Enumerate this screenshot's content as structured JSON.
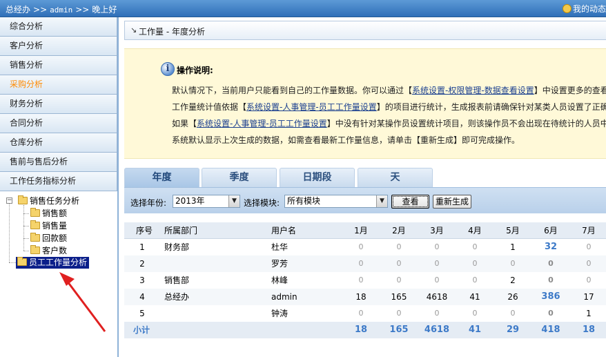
{
  "topbar": {
    "crumbs": [
      "总经办",
      "admin",
      "晚上好"
    ],
    "separator": ">>",
    "my_dynamics": "我的动态"
  },
  "sidebar": {
    "items": [
      {
        "label": "综合分析"
      },
      {
        "label": "客户分析"
      },
      {
        "label": "销售分析"
      },
      {
        "label": "采购分析",
        "active": true
      },
      {
        "label": "财务分析"
      },
      {
        "label": "合同分析"
      },
      {
        "label": "仓库分析"
      },
      {
        "label": "售前与售后分析"
      },
      {
        "label": "工作任务指标分析"
      }
    ],
    "tree": {
      "root": "销售任务分析",
      "children": [
        "销售额",
        "销售量",
        "回款额",
        "客户数"
      ],
      "selected": "员工工作量分析"
    }
  },
  "main": {
    "title": "工作量 - 年度分析",
    "notice": {
      "heading": "操作说明:",
      "line1_a": "默认情况下，当前用户只能看到自己的工作量数据。你可以通过",
      "line1_link": "系统设置-权限管理-数据查看设置",
      "line1_b": "中设置更多的查看",
      "line2_a": "工作量统计值依据",
      "line2_link": "系统设置-人事管理-员工工作量设置",
      "line2_b": "的项目进行统计，生成报表前请确保针对某类人员设置了正确",
      "line3_a": "如果",
      "line3_link": "系统设置-人事管理-员工工作量设置",
      "line3_b": "中没有针对某操作员设置统计项目，则该操作员不会出现在待统计的人员中",
      "line4": "系统默认显示上次生成的数据，如需查看最新工作量信息，请单击【重新生成】即可完成操作。"
    },
    "tabs": [
      {
        "label": "年度",
        "active": true
      },
      {
        "label": "季度"
      },
      {
        "label": "日期段"
      },
      {
        "label": "天"
      }
    ],
    "filter": {
      "year_label": "选择年份:",
      "year_value": "2013年",
      "module_label": "选择模块:",
      "module_value": "所有模块",
      "view_button": "查看",
      "regen_button": "重新生成"
    },
    "table": {
      "headers": [
        "序号",
        "所属部门",
        "用户名",
        "1月",
        "2月",
        "3月",
        "4月",
        "5月",
        "6月",
        "7月"
      ],
      "rows": [
        {
          "no": "1",
          "dept": "财务部",
          "user": "杜华",
          "m": [
            "0",
            "0",
            "0",
            "0",
            "1",
            "32",
            "0"
          ]
        },
        {
          "no": "2",
          "dept": "",
          "user": "罗芳",
          "m": [
            "0",
            "0",
            "0",
            "0",
            "0",
            "0",
            "0"
          ]
        },
        {
          "no": "3",
          "dept": "销售部",
          "user": "林峰",
          "m": [
            "0",
            "0",
            "0",
            "0",
            "2",
            "0",
            "0"
          ]
        },
        {
          "no": "4",
          "dept": "总经办",
          "user": "admin",
          "m": [
            "18",
            "165",
            "4618",
            "41",
            "26",
            "386",
            "17"
          ]
        },
        {
          "no": "5",
          "dept": "",
          "user": "钟涛",
          "m": [
            "0",
            "0",
            "0",
            "0",
            "0",
            "0",
            "1"
          ]
        }
      ],
      "total": {
        "label": "小计",
        "m": [
          "18",
          "165",
          "4618",
          "41",
          "29",
          "418",
          "18"
        ]
      }
    }
  },
  "colors": {
    "topbar": "#2f6fb8",
    "active_menu": "#ff8a00",
    "link": "#1a3f8f",
    "highlight_value": "#3d7ac8",
    "annotation_arrow": "#e02020"
  }
}
